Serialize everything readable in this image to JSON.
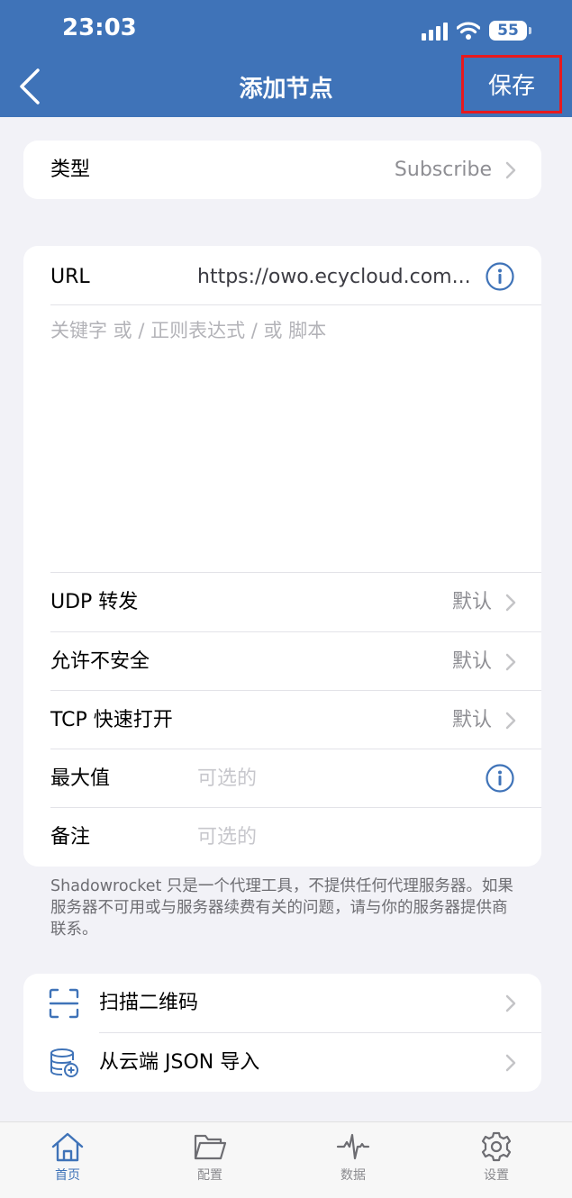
{
  "status_bar": {
    "time": "23:03",
    "battery": "55"
  },
  "nav": {
    "title": "添加节点",
    "save_label": "保存"
  },
  "type_row": {
    "label": "类型",
    "value": "Subscribe"
  },
  "url_row": {
    "label": "URL",
    "value": "https://owo.ecycloud.com..."
  },
  "keyword_placeholder": "关键字 或 / 正则表达式 / 或 脚本",
  "options": [
    {
      "label": "UDP 转发",
      "value": "默认"
    },
    {
      "label": "允许不安全",
      "value": "默认"
    },
    {
      "label": "TCP 快速打开",
      "value": "默认"
    },
    {
      "label": "最大值",
      "placeholder": "可选的"
    },
    {
      "label": "备注",
      "placeholder": "可选的"
    }
  ],
  "footnote": "Shadowrocket 只是一个代理工具，不提供任何代理服务器。如果服务器不可用或与服务器续费有关的问题，请与你的服务器提供商联系。",
  "actions": [
    {
      "label": "扫描二维码",
      "icon": "qr-scan-icon"
    },
    {
      "label": "从云端 JSON 导入",
      "icon": "cloud-database-icon"
    }
  ],
  "tabs": [
    {
      "label": "首页",
      "icon": "home-icon",
      "active": true
    },
    {
      "label": "配置",
      "icon": "folder-icon",
      "active": false
    },
    {
      "label": "数据",
      "icon": "activity-icon",
      "active": false
    },
    {
      "label": "设置",
      "icon": "gear-icon",
      "active": false
    }
  ],
  "colors": {
    "accent": "#3f73b8",
    "highlight_border": "#e8191d",
    "background": "#f2f2f7"
  }
}
